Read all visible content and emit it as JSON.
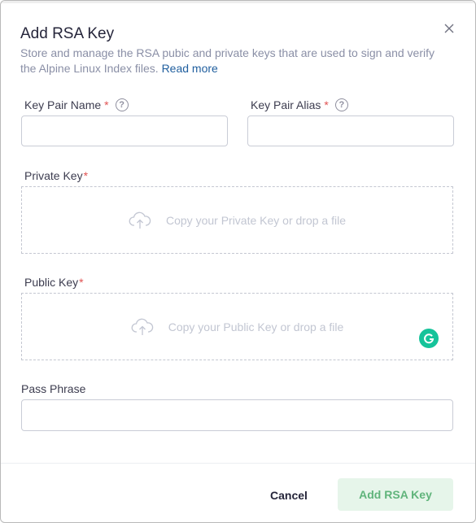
{
  "dialog": {
    "title": "Add RSA Key",
    "description": "Store and manage the RSA pubic and private keys that are used to sign and verify the Alpine Linux Index files.",
    "read_more": "Read more"
  },
  "fields": {
    "key_pair_name": {
      "label": "Key Pair Name",
      "required_mark": "*",
      "help": "?",
      "value": "",
      "placeholder": ""
    },
    "key_pair_alias": {
      "label": "Key Pair Alias",
      "required_mark": "*",
      "help": "?",
      "value": "",
      "placeholder": ""
    },
    "private_key": {
      "label": "Private Key",
      "required_mark": "*",
      "drop_text": "Copy your Private Key or drop a file"
    },
    "public_key": {
      "label": "Public Key",
      "required_mark": "*",
      "drop_text": "Copy your Public Key or drop a file"
    },
    "pass_phrase": {
      "label": "Pass Phrase",
      "value": "",
      "placeholder": ""
    }
  },
  "footer": {
    "cancel_label": "Cancel",
    "submit_label": "Add RSA Key"
  },
  "icons": {
    "close": "close-icon",
    "help": "help-circle-icon",
    "upload": "cloud-upload-icon",
    "grammarly": "grammarly-icon"
  },
  "colors": {
    "link": "#1f5e9e",
    "required": "#e05252",
    "primary_bg": "#e6f5ea",
    "primary_text": "#60b47b",
    "grammarly": "#15c39a"
  }
}
